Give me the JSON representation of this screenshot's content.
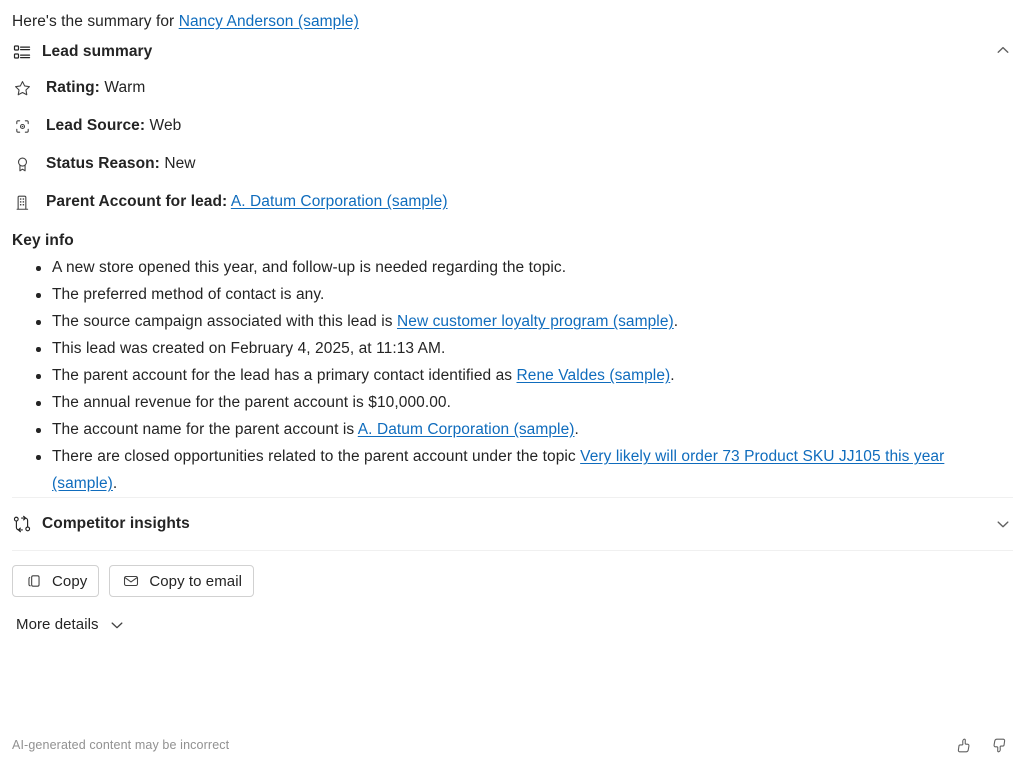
{
  "intro": {
    "prefix": "Here's the summary for ",
    "link": "Nancy Anderson (sample)"
  },
  "lead_summary": {
    "icon": "list-summary-icon",
    "title": "Lead summary",
    "collapse_icon": "chevron-up-icon",
    "attributes": [
      {
        "icon": "star-icon",
        "label": "Rating:",
        "value": "Warm"
      },
      {
        "icon": "target-icon",
        "label": "Lead Source:",
        "value": "Web"
      },
      {
        "icon": "ribbon-icon",
        "label": "Status Reason:",
        "value": "New"
      },
      {
        "icon": "building-icon",
        "label": "Parent Account for lead:",
        "value": "A. Datum Corporation (sample)",
        "value_is_link": true
      }
    ],
    "key_info_title": "Key info",
    "key_info": [
      {
        "segments": [
          {
            "t": "A new store opened this year, and follow-up is needed regarding the topic."
          }
        ]
      },
      {
        "segments": [
          {
            "t": "The preferred method of contact is any."
          }
        ]
      },
      {
        "segments": [
          {
            "t": "The source campaign associated with this lead is "
          },
          {
            "t": "New customer loyalty program (sample)",
            "link": true
          },
          {
            "t": "."
          }
        ]
      },
      {
        "segments": [
          {
            "t": "This lead was created on February 4, 2025, at 11:13 AM."
          }
        ]
      },
      {
        "segments": [
          {
            "t": "The parent account for the lead has a primary contact identified as "
          },
          {
            "t": "Rene Valdes (sample)",
            "link": true
          },
          {
            "t": "."
          }
        ]
      },
      {
        "segments": [
          {
            "t": "The annual revenue for the parent account is $10,000.00."
          }
        ]
      },
      {
        "segments": [
          {
            "t": "The account name for the parent account is "
          },
          {
            "t": "A. Datum Corporation (sample)",
            "link": true
          },
          {
            "t": "."
          }
        ]
      },
      {
        "segments": [
          {
            "t": "There are closed opportunities related to the parent account under the topic "
          },
          {
            "t": "Very likely will order 73 Product SKU JJ105 this year (sample)",
            "link": true
          },
          {
            "t": "."
          }
        ]
      }
    ]
  },
  "competitor_insights": {
    "icon": "compare-branch-icon",
    "title": "Competitor insights",
    "expand_icon": "chevron-down-icon"
  },
  "actions": {
    "copy": {
      "icon": "copy-icon",
      "label": "Copy"
    },
    "copy_to_email": {
      "icon": "envelope-icon",
      "label": "Copy to email"
    }
  },
  "more_details": {
    "label": "More details",
    "icon": "chevron-down-icon"
  },
  "footer": {
    "disclaimer": "AI-generated content may be incorrect",
    "thumbs_up": "thumbs-up-icon",
    "thumbs_down": "thumbs-down-icon"
  },
  "colors": {
    "link": "#0f6cbd",
    "text": "#242424",
    "muted": "#919191",
    "divider": "#f0f0f0",
    "border": "#d1d1d1"
  }
}
